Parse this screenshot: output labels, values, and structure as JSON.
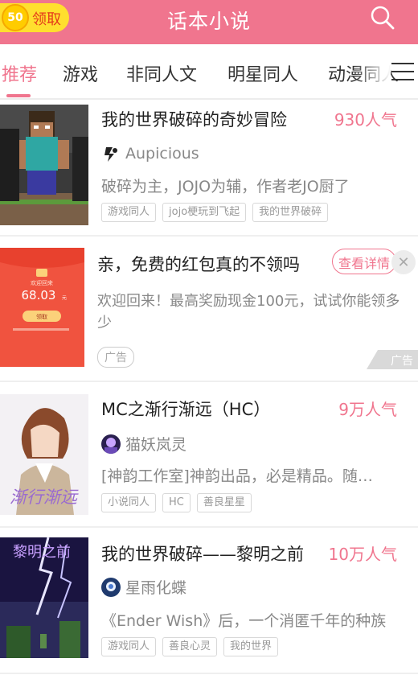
{
  "header": {
    "coin_value": "50",
    "claim_label": "领取",
    "title": "话本小说",
    "search_icon": "search-icon",
    "accent_color": "#f0758e"
  },
  "tabs": [
    {
      "label": "推荐",
      "active": true
    },
    {
      "label": "游戏"
    },
    {
      "label": "非同人文"
    },
    {
      "label": "明星同人"
    },
    {
      "label": "动漫同人"
    }
  ],
  "books": [
    {
      "title": "我的世界破碎的奇妙冒险",
      "popularity": "930人气",
      "author": "Aupicious",
      "description": "破碎为主，JOJO为辅，作者老JO厨了",
      "tags": [
        "游戏同人",
        "jojo梗玩到飞起",
        "我的世界破碎"
      ]
    },
    {
      "title": "MC之渐行渐远（HC）",
      "popularity": "9万人气",
      "author": "猫妖岚灵",
      "description": "[神韵工作室]神韵出品，必是精品。随…",
      "tags": [
        "小说同人",
        "HC",
        "善良星星"
      ]
    },
    {
      "title": "我的世界破碎——黎明之前",
      "popularity": "10万人气",
      "author": "星雨化蝶",
      "description": "《Ender Wish》后，一个消匿千年的种族",
      "tags": [
        "游戏同人",
        "善良心灵",
        "我的世界"
      ]
    }
  ],
  "ad": {
    "title": "亲，免费的红包真的不领吗",
    "button_label": "查看详情",
    "description": "欢迎回来！最高奖励现金100元，试试你能领多少",
    "label": "广告",
    "mark": "广告",
    "cover_text": "欢迎回来",
    "cover_amount": "68.03",
    "cover_unit": "元",
    "cover_button": "领取"
  },
  "cover2_text": "渐行渐远",
  "cover3_text": "黎明之前"
}
